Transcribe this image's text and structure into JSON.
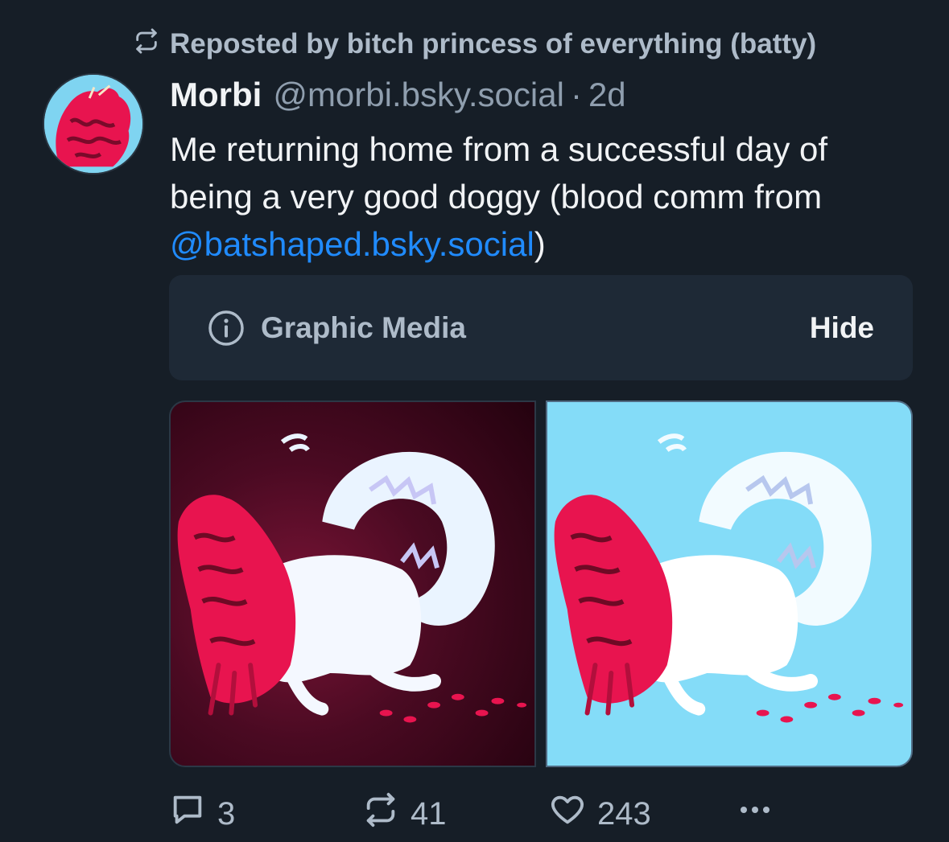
{
  "repost": {
    "label": "Reposted by bitch princess of everything (batty)",
    "icon": "repost-icon"
  },
  "author": {
    "display_name": "Morbi",
    "handle": "@morbi.bsky.social",
    "separator": "·",
    "time": "2d"
  },
  "post": {
    "text_before": "Me returning home from a successful day of being a very good doggy (blood comm from ",
    "mention": "@batshaped.bsky.social",
    "text_after": ")"
  },
  "content_warning": {
    "icon": "info-icon",
    "label": "Graphic Media",
    "hide_label": "Hide"
  },
  "media": [
    {
      "name": "dark-background-artwork",
      "background": "#4a0a22"
    },
    {
      "name": "blue-background-artwork",
      "background": "#84dcf8"
    }
  ],
  "actions": {
    "reply_count": "3",
    "repost_count": "41",
    "like_count": "243",
    "more_icon": "ellipsis-icon"
  },
  "colors": {
    "background": "#161e27",
    "text": "#f1f3f5",
    "muted": "#8f9eae",
    "link": "#208bfe",
    "card": "#1e2936"
  }
}
